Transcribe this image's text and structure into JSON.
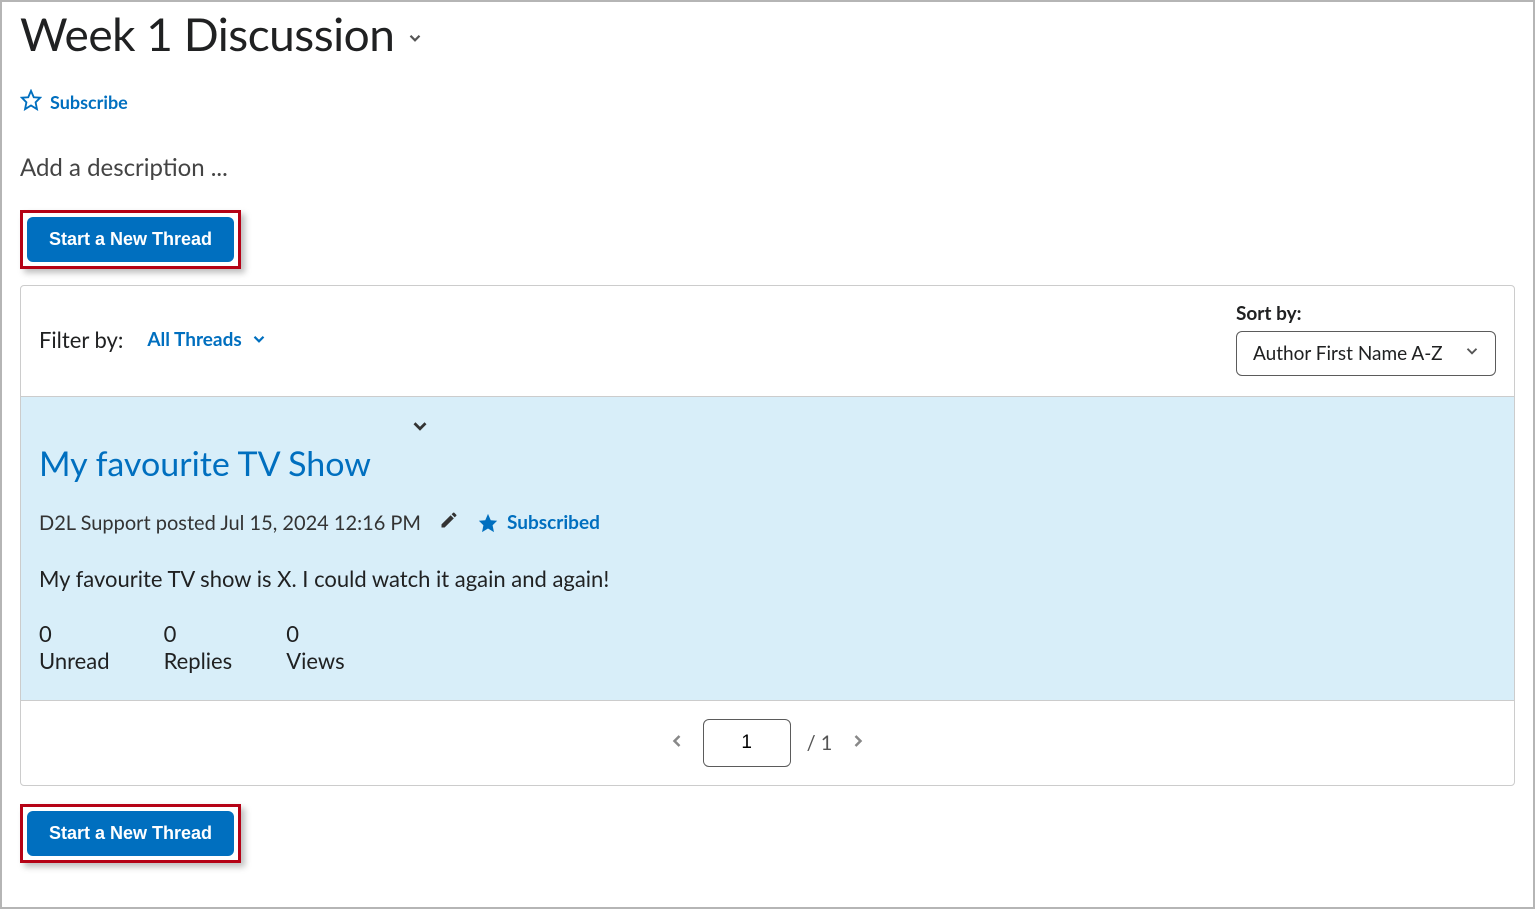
{
  "header": {
    "title": "Week 1 Discussion",
    "subscribe_label": "Subscribe",
    "description_placeholder": "Add a description ..."
  },
  "buttons": {
    "new_thread": "Start a New Thread"
  },
  "filter": {
    "label": "Filter by:",
    "dropdown_value": "All Threads"
  },
  "sort": {
    "label": "Sort by:",
    "selected": "Author First Name A-Z"
  },
  "threads": [
    {
      "title": "My favourite TV Show",
      "meta": "D2L Support posted Jul 15, 2024 12:16 PM",
      "subscribed_label": "Subscribed",
      "body": "My favourite TV show is X. I could watch it again and again!",
      "stats": {
        "unread_value": "0",
        "unread_label": "Unread",
        "replies_value": "0",
        "replies_label": "Replies",
        "views_value": "0",
        "views_label": "Views"
      }
    }
  ],
  "pagination": {
    "current": "1",
    "total": "/ 1"
  }
}
